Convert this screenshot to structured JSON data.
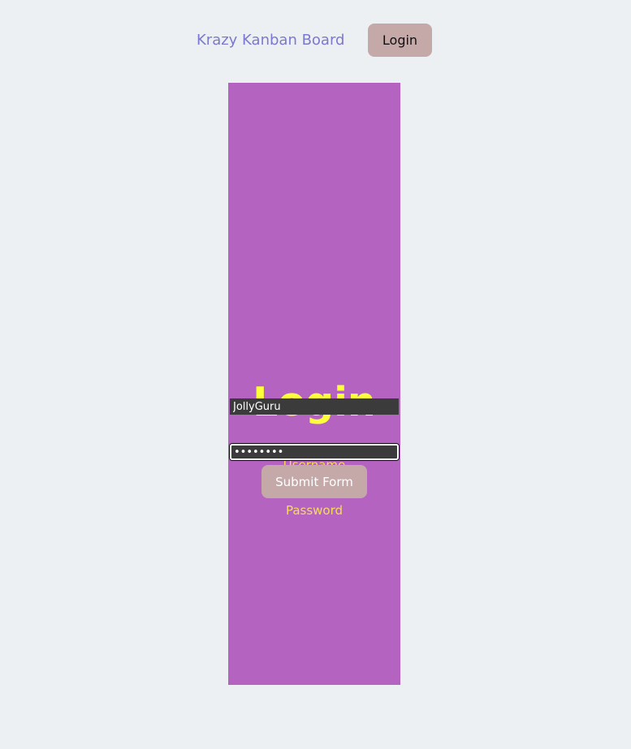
{
  "header": {
    "brand": "Krazy Kanban Board",
    "login_button_label": "Login"
  },
  "form": {
    "title": "Login",
    "username_label": "Username",
    "username_value": "JollyGuru",
    "password_label": "Password",
    "password_value": "password",
    "submit_label": "Submit Form"
  },
  "colors": {
    "background": "#edf0f2",
    "brand": "#7b78cf",
    "button": "#c5a8a8",
    "panel": "#b463c0",
    "title": "#fefe3a",
    "label": "#f6dc5c",
    "input_bg": "#3b3b3b"
  }
}
